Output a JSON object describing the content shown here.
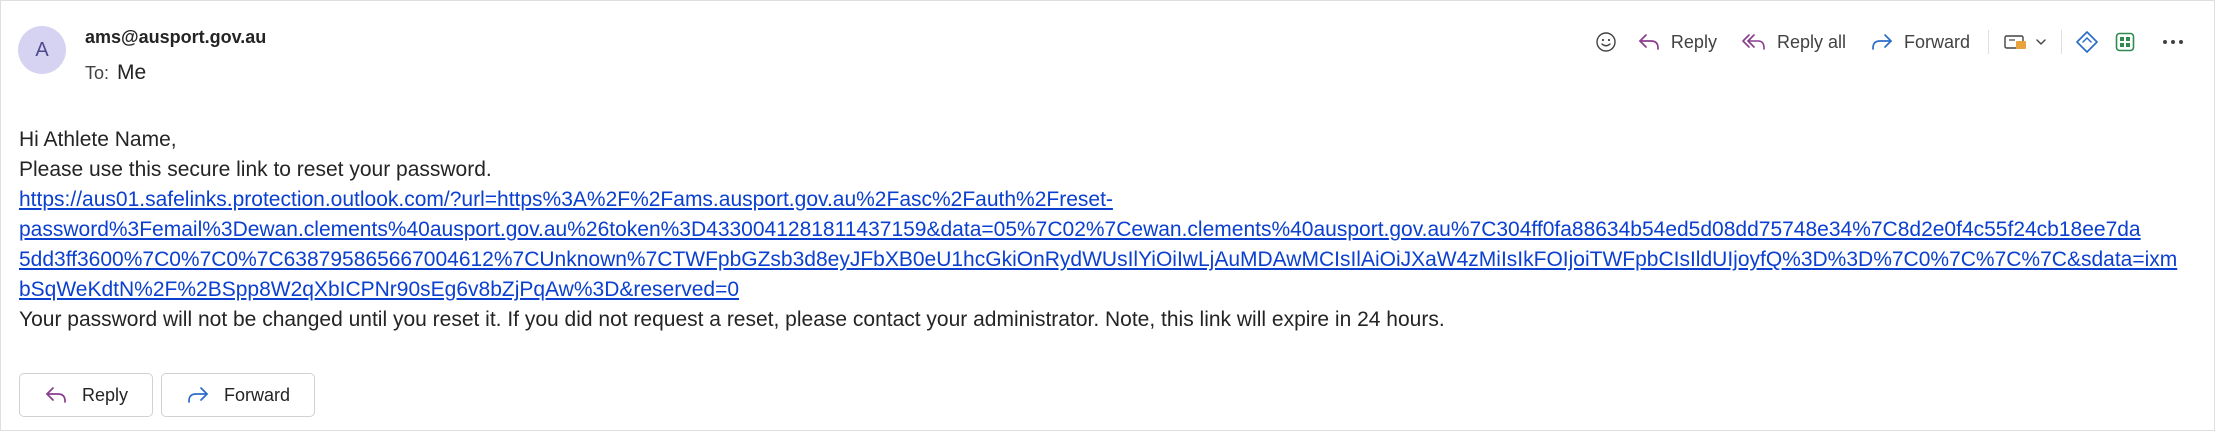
{
  "header": {
    "avatar_initial": "A",
    "from": "ams@ausport.gov.au",
    "to_label": "To:",
    "to_value": "Me"
  },
  "toolbar": {
    "emoji_icon": "smile-icon",
    "reply_label": "Reply",
    "reply_all_label": "Reply all",
    "forward_label": "Forward",
    "apps_icon": "apps-icon",
    "more_icon": "more-icon"
  },
  "body": {
    "greeting_prefix": "Hi ",
    "greeting_name": "Athlete Name,",
    "line1": "Please use this secure link to reset your password.",
    "link": "https://aus01.safelinks.protection.outlook.com/?url=https%3A%2F%2Fams.ausport.gov.au%2Fasc%2Fauth%2Freset-password%3Femail%3Dewan.clements%40ausport.gov.au%26token%3D433004128181 1437159&data=05%7C02%7Cewan.clements%40ausport.gov.au%7C304ff0fa88634b54ed5d08dd75748e34%7C8d2e0f4c55f24cb18ee7da5dd3ff3600%7C0%7C0%7C638795865667004612%7CUnknown%7CTWFpbGZsb3d8eyJFbXB0eU1hcGkiOnRydWUsIlYiOiIwLjAuMDAwMCIsIlAiOiJXaW4zMiIsIkFOIjoiTWFpbCIsIldUIjoyfQ%3D%3D%7C0%7C%7C%7C&sdata=ixmbSqWeKdtN%2F%2BSpp8W2qXbICPNr90sEg6v8bZjPqAw%3D&reserved=0",
    "link_lines": [
      "https://aus01.safelinks.protection.outlook.com/?url=https%3A%2F%2Fams.ausport.gov.au%2Fasc%2Fauth%2Freset-",
      "password%3Femail%3Dewan.clements%40ausport.gov.au%26token%3D4330041281811437159&data=05%7C02%7Cewan.clements%40ausport.gov.au%7C304ff0fa88634b54ed5d08dd75748e34%7C8d2e0f4c55f24cb18ee7da",
      "5dd3ff3600%7C0%7C0%7C638795865667004612%7CUnknown%7CTWFpbGZsb3d8eyJFbXB0eU1hcGkiOnRydWUsIlYiOiIwLjAuMDAwMCIsIlAiOiJXaW4zMiIsIkFOIjoiTWFpbCIsIldUIjoyfQ%3D%3D%7C0%7C%7C%7C&sdata=ixm",
      "bSqWeKdtN%2F%2BSpp8W2qXbICPNr90sEg6v8bZjPqAw%3D&reserved=0"
    ],
    "line2": "Your password will not be changed until you reset it. If you did not request a reset, please contact your administrator. Note, this link will expire in 24 hours."
  },
  "bottom": {
    "reply_label": "Reply",
    "forward_label": "Forward"
  },
  "colors": {
    "link": "#0b3fd0",
    "reply_icon": "#8a3c8f",
    "forward_icon": "#2a6dc9",
    "avatar_bg": "#d6d2f2"
  }
}
